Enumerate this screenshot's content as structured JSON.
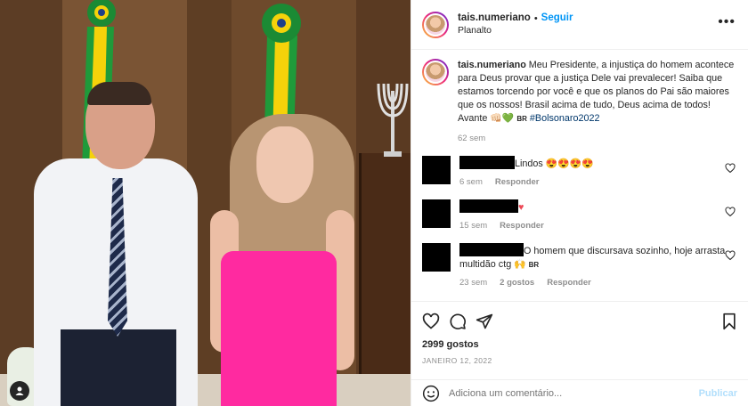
{
  "post": {
    "username": "tais.numeriano",
    "separator": "•",
    "follow_label": "Seguir",
    "location": "Planalto",
    "caption": "Meu Presidente, a injustiça do homem acontece para Deus provar que a justiça Dele vai prevalecer! Saiba que estamos torcendo por você e que os planos do Pai são maiores que os nossos! Brasil acima de tudo, Deus acima de todos! Avante 👊🏻💚",
    "caption_flag": "BR",
    "hashtag": "#Bolsonaro2022",
    "caption_age": "62 sem"
  },
  "comments": [
    {
      "text": "Lindos 😍😍😍😍",
      "age": "6 sem",
      "likes": "",
      "reply_label": "Responder"
    },
    {
      "text": "♥",
      "age": "15 sem",
      "likes": "",
      "reply_label": "Responder"
    },
    {
      "text": "O homem que discursava sozinho, hoje arrasta multidão ctg 🙌",
      "flag": "BR",
      "age": "23 sem",
      "likes": "2 gostos",
      "reply_label": "Responder"
    }
  ],
  "stats": {
    "likes": "2999 gostos",
    "date": "JANEIRO 12, 2022"
  },
  "composer": {
    "placeholder": "Adiciona um comentário...",
    "post_label": "Publicar"
  },
  "icons": {
    "more": "more-options-icon",
    "like": "heart-icon",
    "comment": "comment-icon",
    "share": "share-icon",
    "save": "bookmark-icon",
    "emoji": "emoji-icon",
    "tag": "user-tag-icon"
  },
  "colors": {
    "accent": "#0095f6",
    "post_disabled": "#b2dffc",
    "meta": "#8e8e8e"
  }
}
